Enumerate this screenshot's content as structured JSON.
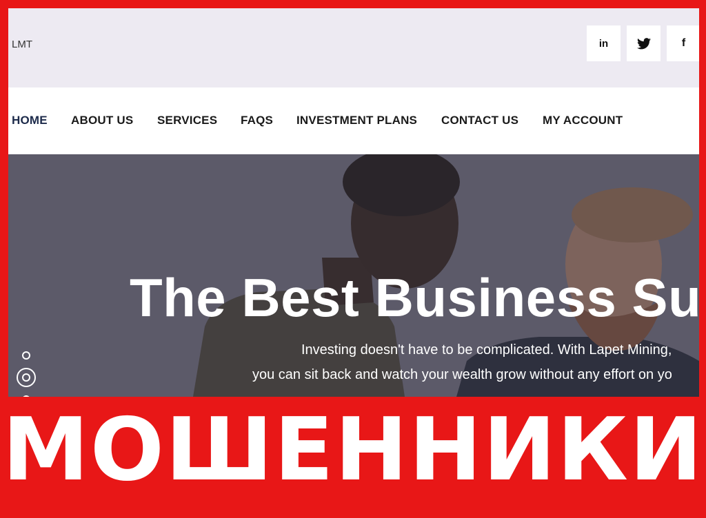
{
  "header": {
    "logo": "LMT",
    "social": [
      {
        "name": "linkedin",
        "label": "in"
      },
      {
        "name": "twitter",
        "label": ""
      },
      {
        "name": "facebook",
        "label": "f"
      }
    ]
  },
  "nav": {
    "items": [
      "HOME",
      "ABOUT US",
      "SERVICES",
      "FAQS",
      "INVESTMENT PLANS",
      "CONTACT US",
      "MY ACCOUNT"
    ]
  },
  "hero": {
    "title": "The Best Business Su",
    "subtitle_line1": "Investing doesn't have to be complicated. With Lapet Mining,",
    "subtitle_line2": "you can sit back and watch your wealth grow without any effort on yo"
  },
  "banner": {
    "text": "МОШЕННИКИ"
  },
  "colors": {
    "banner_red": "#e81717",
    "topbar_bg": "#edeaf2",
    "hero_bg": "#605e6a"
  }
}
